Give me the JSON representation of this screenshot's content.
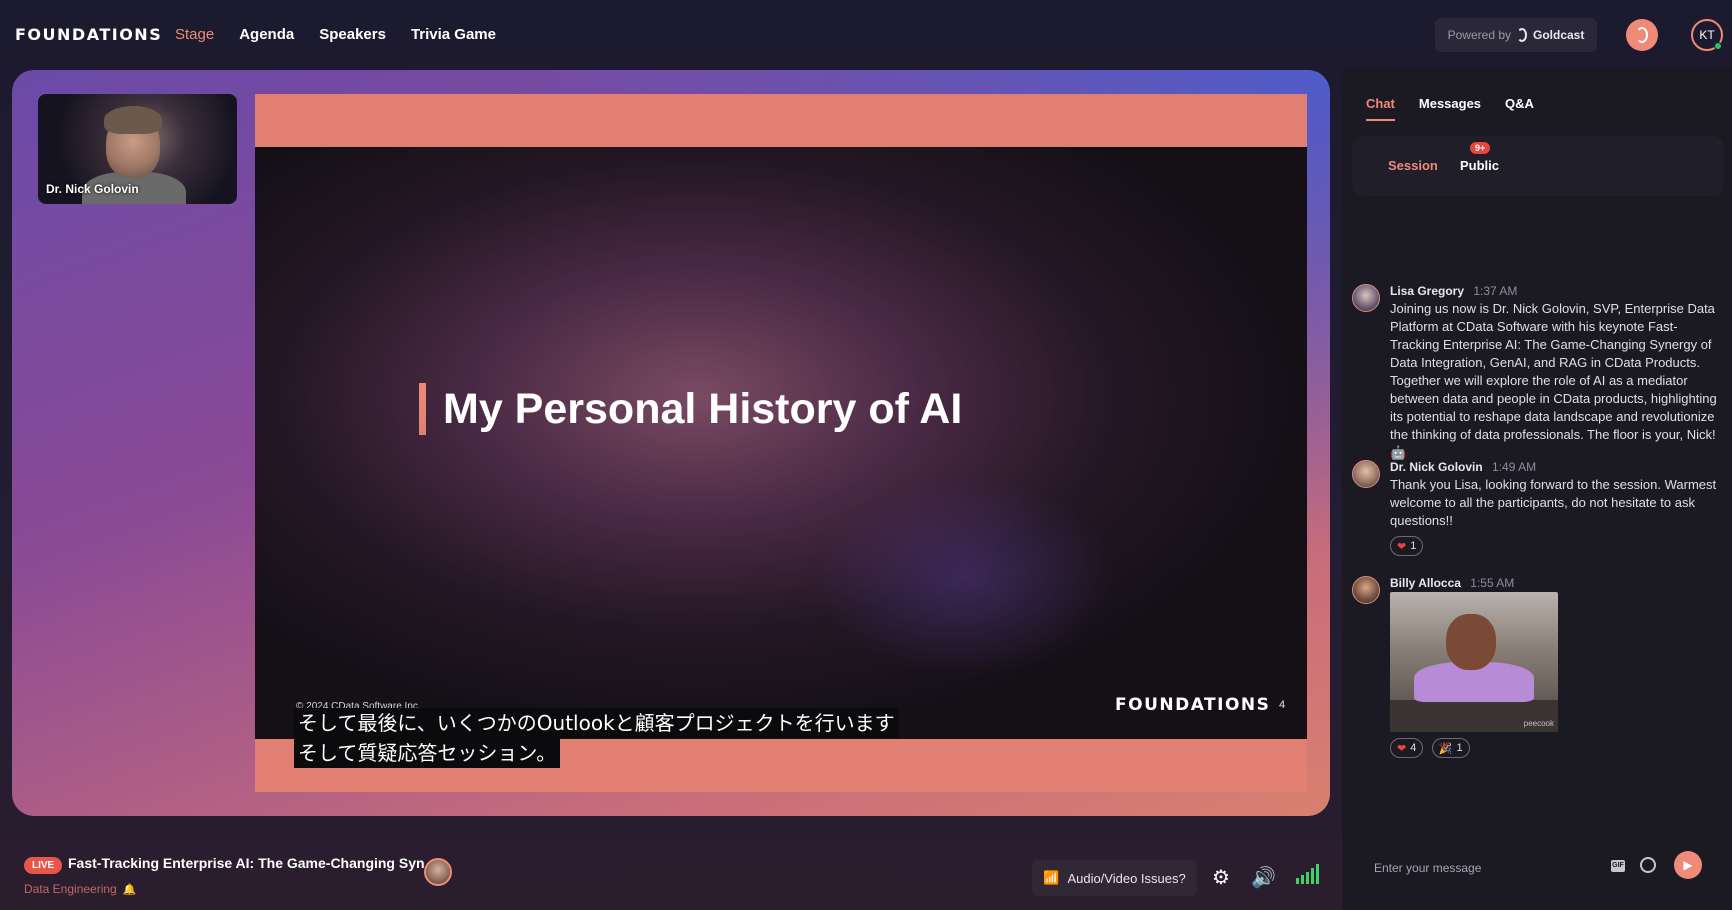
{
  "header": {
    "logo_text": "FOUNDATIONS",
    "nav": [
      {
        "label": "Stage",
        "active": true
      },
      {
        "label": "Agenda",
        "active": false
      },
      {
        "label": "Speakers",
        "active": false
      },
      {
        "label": "Trivia Game",
        "active": false
      }
    ],
    "powered_by": "Powered by",
    "powered_brand": "Goldcast",
    "user_initials": "KT"
  },
  "stage": {
    "speaker_name": "Dr. Nick Golovin",
    "slide": {
      "title": "My Personal History of AI",
      "copyright": "© 2024 CData Software Inc.",
      "logo_text": "FOUNDATIONS",
      "page_number": "4"
    },
    "captions": [
      "そして最後に、いくつかのOutlookと顧客プロジェクトを行います",
      "そして質疑応答セッション。"
    ]
  },
  "bottom_bar": {
    "live_label": "LIVE",
    "session_title": "Fast-Tracking Enterprise AI: The Game-Changing Syn...",
    "track": "Data Engineering",
    "av_issues_label": "Audio/Video Issues?",
    "signal_level": 1.0
  },
  "chat_panel": {
    "tabs": [
      {
        "label": "Chat",
        "active": true
      },
      {
        "label": "Messages",
        "active": false
      },
      {
        "label": "Q&A",
        "active": false
      }
    ],
    "subtabs": {
      "session": "Session",
      "public": "Public",
      "public_badge": "9+"
    },
    "messages": [
      {
        "author": "Lisa Gregory",
        "time": "1:37 AM",
        "text": "Joining us now is Dr. Nick Golovin, SVP, Enterprise Data Platform at CData Software with his keynote Fast-Tracking Enterprise AI: The Game-Changing Synergy of Data Integration, GenAI, and RAG in CData Products. Together we will explore the role of AI as a mediator between data and people in CData products, highlighting its potential to reshape data landscape and revolutionize the thinking of data professionals. The floor is your, Nick! 🤖"
      },
      {
        "author": "Dr. Nick Golovin",
        "time": "1:49 AM",
        "text": "Thank you Lisa, looking forward to the session. Warmest welcome to all the participants, do not hesitate to ask questions!!",
        "reactions": [
          {
            "emoji": "heart",
            "count": "1"
          }
        ]
      },
      {
        "author": "Billy Allocca",
        "time": "1:55 AM",
        "gif_watermark": "peecook",
        "reactions": [
          {
            "emoji": "heart",
            "count": "4"
          },
          {
            "emoji": "party",
            "count": "1"
          }
        ]
      }
    ],
    "composer_placeholder": "Enter your message",
    "gif_label": "GIF"
  },
  "colors": {
    "accent": "#ef8a78",
    "live_red": "#e8564a",
    "panel_bg": "#1b1922"
  }
}
